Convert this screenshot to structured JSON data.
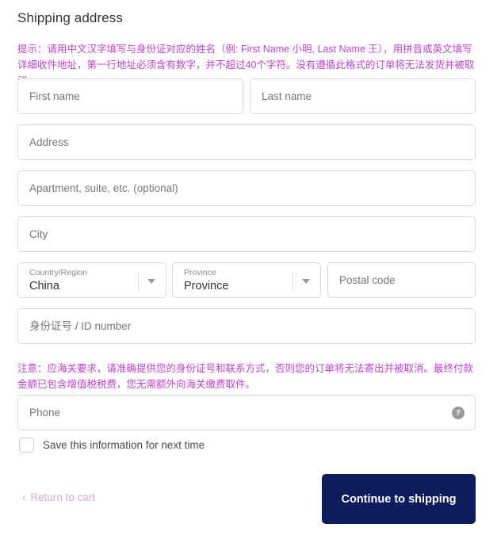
{
  "page": {
    "section_title": "Shipping address"
  },
  "notices": {
    "tip": "提示：请用中文汉字填写与身份证对应的姓名（例: First Name 小明, Last Name 王），用拼音或英文填写详细收件地址，第一行地址必须含有数字，并不超过40个字符。没有遵循此格式的订单将无法发货并被取消。",
    "customs": "注意：应海关要求，请准确提供您的身份证号和联系方式，否则您的订单将无法寄出并被取消。最终付款金额已包含增值税税费，您无需额外向海关缴费取件。"
  },
  "form": {
    "first_name": {
      "placeholder": "First name",
      "value": ""
    },
    "last_name": {
      "placeholder": "Last name",
      "value": ""
    },
    "address": {
      "placeholder": "Address",
      "value": ""
    },
    "apartment": {
      "placeholder": "Apartment, suite, etc. (optional)",
      "value": ""
    },
    "city": {
      "placeholder": "City",
      "value": ""
    },
    "country": {
      "label": "Country/Region",
      "value": "China"
    },
    "province": {
      "label": "Province",
      "value": "Province"
    },
    "postal_code": {
      "placeholder": "Postal code",
      "value": ""
    },
    "id_number": {
      "placeholder": "身份证号 / ID number",
      "value": ""
    },
    "phone": {
      "placeholder": "Phone",
      "value": "",
      "help_glyph": "?"
    }
  },
  "save_info": {
    "label": "Save this information for next time",
    "checked": false
  },
  "footer": {
    "return_chevron": "‹",
    "return_label": "Return to cart",
    "continue_label": "Continue to shipping"
  },
  "colors": {
    "notice_magenta": "#c03fd0",
    "return_link_pink": "#d6a8d8",
    "button_navy": "#0c1c5c",
    "field_border": "#d9d9d9",
    "placeholder_grey": "#767676"
  }
}
